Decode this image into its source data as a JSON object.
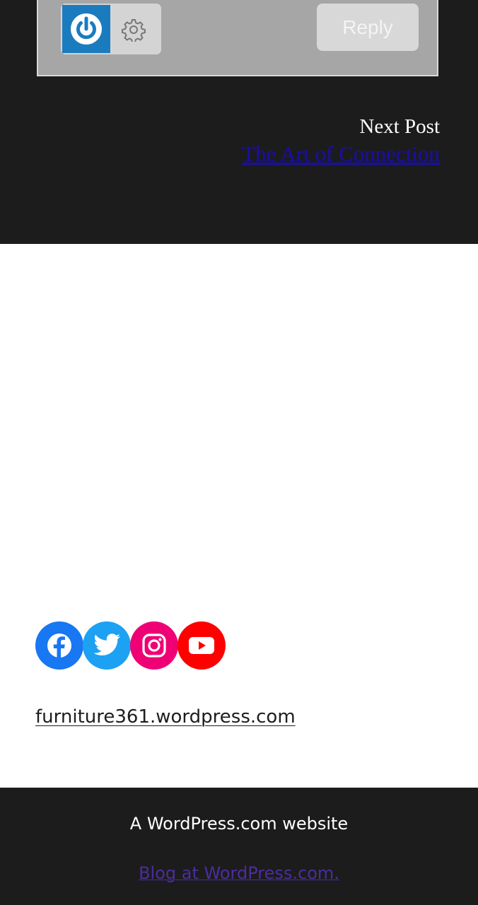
{
  "comment_form": {
    "power_icon": "power-icon",
    "settings_icon": "gear-icon",
    "reply_label": "Reply"
  },
  "post_navigation": {
    "next_label": "Next Post",
    "next_title": "The Art of Connection"
  },
  "social_links": [
    {
      "name": "facebook-icon",
      "color": "#1877f2"
    },
    {
      "name": "twitter-icon",
      "color": "#1da1f2"
    },
    {
      "name": "instagram-icon",
      "color": "#f00075"
    },
    {
      "name": "youtube-icon",
      "color": "#ff0000"
    }
  ],
  "site": {
    "domain": "furniture361.wordpress.com"
  },
  "footer": {
    "tagline": "A WordPress.com website",
    "credit": "Blog at WordPress.com."
  }
}
